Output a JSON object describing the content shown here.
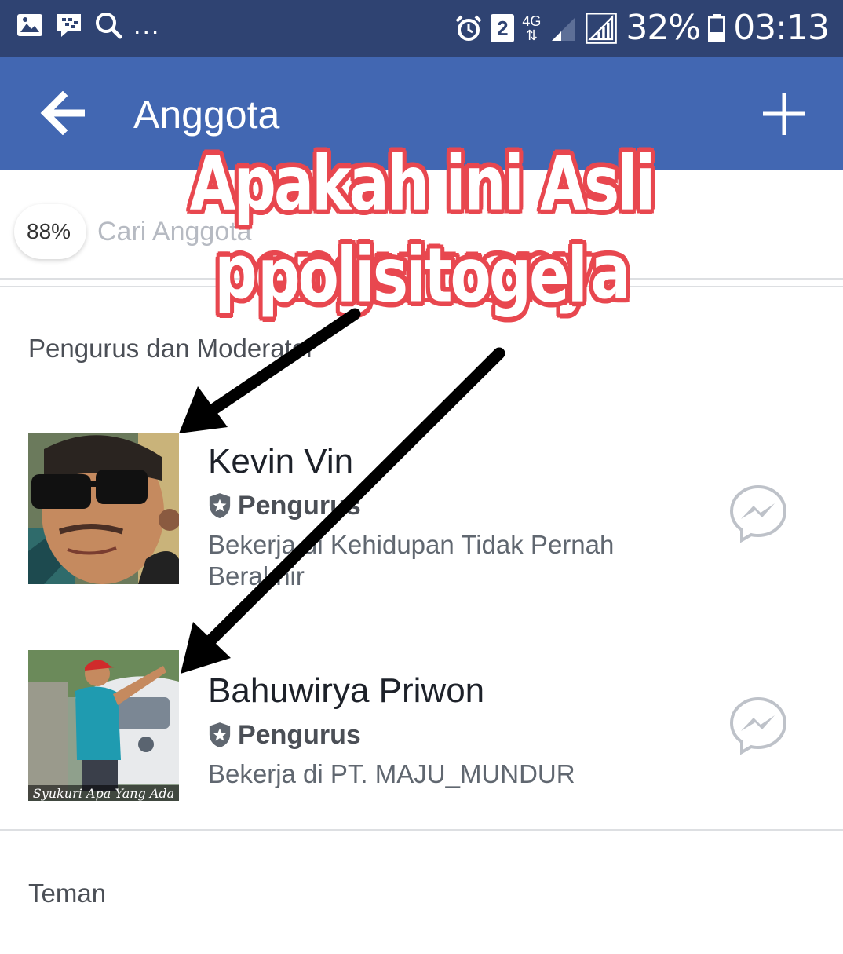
{
  "status_bar": {
    "more": "...",
    "notification_count": "2",
    "network": "4G",
    "battery": "32%",
    "time": "03:13"
  },
  "app_bar": {
    "title": "Anggota"
  },
  "search": {
    "zoom": "88%",
    "placeholder": "Cari Anggota"
  },
  "sections": {
    "admins_title": "Pengurus dan Moderator",
    "friends_title": "Teman"
  },
  "members": [
    {
      "name": "Kevin Vin",
      "role": "Pengurus",
      "description": "Bekerja di Kehidupan Tidak Pernah Berakhir"
    },
    {
      "name": "Bahuwirya Priwon",
      "role": "Pengurus",
      "description": "Bekerja di PT. MAJU_MUNDUR",
      "photo_caption": "Syukuri Apa Yang Ada"
    }
  ],
  "overlay": {
    "line1": "Apakah ini Asli pengurusnya",
    "line2": "polisitogel",
    "color": "#e8474f"
  },
  "icons": {
    "back": "arrow-left-icon",
    "add": "plus-icon",
    "role": "shield-star-icon",
    "message": "messenger-icon"
  }
}
